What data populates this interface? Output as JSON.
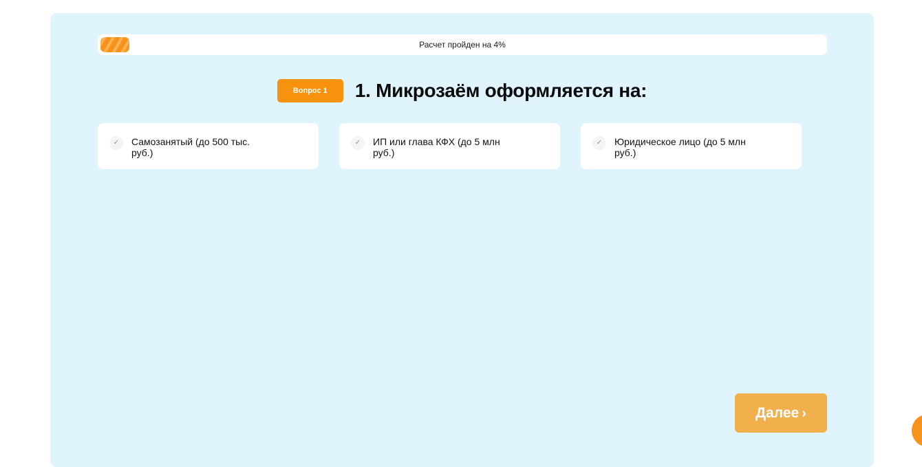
{
  "progress": {
    "text": "Расчет пройден на 4%",
    "percent": 4,
    "fill_color": "#f7931a"
  },
  "question": {
    "badge": "Вопрос 1",
    "title": "1. Микрозаём оформляется на:"
  },
  "options": [
    {
      "label": "Самозанятый (до 500 тыс. руб.)",
      "check_icon": "✓"
    },
    {
      "label": "ИП или глава КФХ (до 5 млн руб.)",
      "check_icon": "✓"
    },
    {
      "label": "Юридическое лицо (до 5 млн руб.)",
      "check_icon": "✓"
    }
  ],
  "next_button": {
    "label": "Далее",
    "chevron": "›"
  },
  "colors": {
    "accent": "#f7920d",
    "card_background": "#e0f4fd",
    "next_button": "#f1b04c"
  }
}
